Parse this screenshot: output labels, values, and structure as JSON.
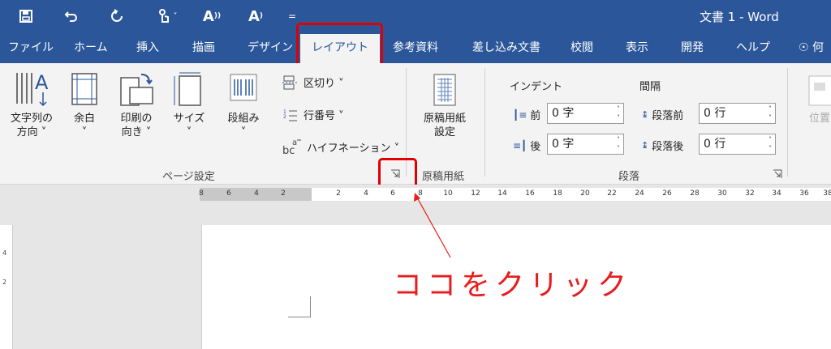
{
  "window": {
    "title": "文書 1  -  Word"
  },
  "qat": {
    "save_icon": "save-icon",
    "undo_icon": "undo-icon",
    "redo_icon": "redo-icon",
    "touch_icon": "touch-mode-icon",
    "font_up": "A",
    "font_down": "A",
    "customize": "="
  },
  "tabs": [
    "ファイル",
    "ホーム",
    "挿入",
    "描画",
    "デザイン",
    "レイアウト",
    "参考資料",
    "差し込み文書",
    "校閲",
    "表示",
    "開発",
    "ヘルプ",
    "何"
  ],
  "active_tab": "レイアウト",
  "ribbon": {
    "page_setup": {
      "text_direction": [
        "文字列の",
        "方向 ˅"
      ],
      "margins": [
        "余白",
        "˅"
      ],
      "orientation": [
        "印刷の",
        "向き ˅"
      ],
      "size": [
        "サイズ",
        "˅"
      ],
      "columns": [
        "段組み",
        "˅"
      ],
      "breaks": "区切り ˅",
      "line_numbers": "行番号 ˅",
      "hyphenation": "ハイフネーション ˅",
      "label": "ページ設定"
    },
    "manuscript": {
      "button": [
        "原稿用紙",
        "設定"
      ],
      "label": "原稿用紙"
    },
    "paragraph": {
      "indent_heading": "インデント",
      "spacing_heading": "間隔",
      "indent_before_label": "前",
      "indent_before_value": "0 字",
      "indent_after_label": "後",
      "indent_after_value": "0 字",
      "space_before_label": "段落前",
      "space_before_value": "0 行",
      "space_after_label": "段落後",
      "space_after_value": "0 行",
      "label": "段落"
    },
    "arrange": {
      "position": "位置"
    }
  },
  "ruler": {
    "ticks": [
      "8",
      "6",
      "4",
      "2",
      "2",
      "4",
      "6",
      "8",
      "10",
      "12",
      "14",
      "16",
      "18",
      "20",
      "22",
      "24",
      "26",
      "28",
      "30",
      "32",
      "34",
      "36",
      "38"
    ]
  },
  "vruler": {
    "ticks": [
      "4",
      "2"
    ]
  },
  "annotation": {
    "text": "ココをクリック",
    "color": "#e81c1c"
  },
  "colors": {
    "accent": "#2b579a",
    "highlight": "#e00000"
  }
}
